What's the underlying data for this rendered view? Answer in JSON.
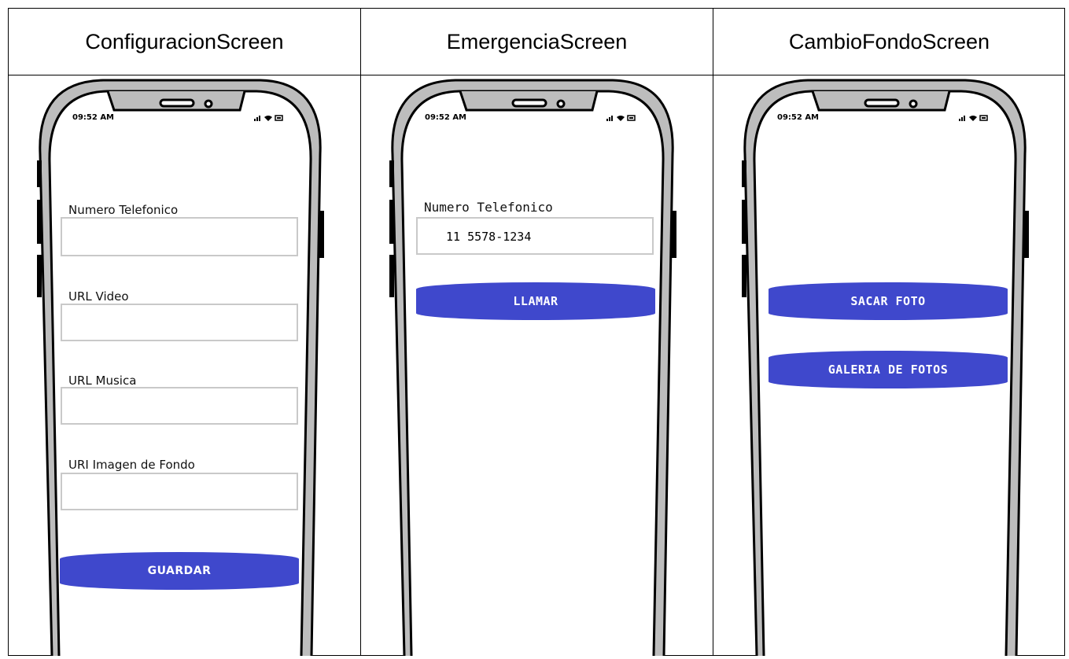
{
  "columns": [
    {
      "title": "ConfiguracionScreen",
      "time": "09:52 AM",
      "fields": [
        {
          "label": "Numero Telefonico",
          "value": ""
        },
        {
          "label": "URL Video",
          "value": ""
        },
        {
          "label": "URL Musica",
          "value": ""
        },
        {
          "label": "URI Imagen de Fondo",
          "value": ""
        }
      ],
      "button": "GUARDAR"
    },
    {
      "title": "EmergenciaScreen",
      "time": "09:52 AM",
      "field": {
        "label": "Numero Telefonico",
        "value": "11 5578-1234"
      },
      "button": "LLAMAR"
    },
    {
      "title": "CambioFondoScreen",
      "time": "09:52 AM",
      "buttons": [
        "SACAR FOTO",
        "GALERIA DE FOTOS"
      ]
    }
  ],
  "colors": {
    "button": "#3f48cc",
    "phone_frame": "#bdbdbd",
    "input_border": "#c9c9c9"
  },
  "icons": [
    "signal-icon",
    "wifi-icon",
    "battery-icon",
    "speaker-icon",
    "camera-icon"
  ]
}
